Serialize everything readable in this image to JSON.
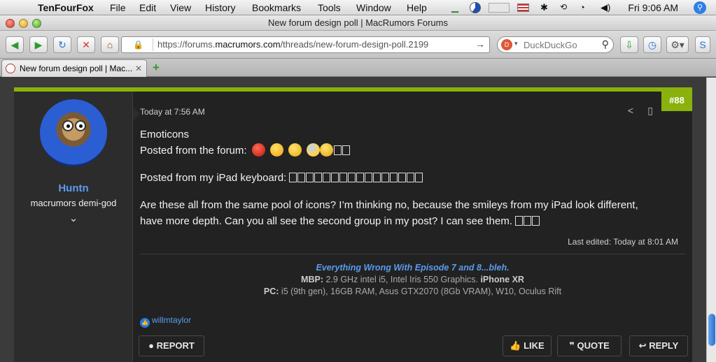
{
  "menubar": {
    "app": "TenFourFox",
    "items": [
      "File",
      "Edit",
      "View",
      "History",
      "Bookmarks",
      "Tools",
      "Window",
      "Help"
    ],
    "clock": "Fri 9:06 AM"
  },
  "window": {
    "title": "New forum design poll | MacRumors Forums"
  },
  "toolbar": {
    "url_prefix": "https://forums.",
    "url_domain": "macrumors.com",
    "url_path": "/threads/new-forum-design-poll.2199",
    "search_placeholder": "DuckDuckGo"
  },
  "tabs": [
    {
      "label": "New forum design poll | Mac..."
    }
  ],
  "post": {
    "user": {
      "name": "Huntn",
      "title": "macrumors demi-god"
    },
    "timestamp": "Today at 7:56 AM",
    "post_number": "#88",
    "body": {
      "line1": "Emoticons",
      "line2": "Posted from the forum:",
      "line3": "Posted from my iPad keyboard:",
      "line4": "Are these all from the same pool of icons? I’m thinking no, because the smileys from my iPad look different,",
      "line5": "have more depth. Can you all see the second group in my post? I can see them."
    },
    "edited": "Last edited: Today at 8:01 AM",
    "signature": {
      "line1a": "Everything Wrong With Episode 7",
      "line1b": "and",
      "line1c": "8...bleh.",
      "mbp_label": "MBP:",
      "mbp_value": "2.9 GHz intel i5, Intel Iris 550 Graphics.",
      "iphone": "iPhone XR",
      "pc_label": "PC:",
      "pc_value": "i5 (9th gen), 16GB RAM, Asus GTX2070 (8Gb VRAM), W10, Oculus Rift"
    },
    "liked_by": "willmtaylor",
    "buttons": {
      "report": "REPORT",
      "like": "LIKE",
      "quote": "QUOTE",
      "reply": "REPLY"
    }
  },
  "colors": {
    "accent": "#8ab10c",
    "link": "#5b9bef",
    "panel": "#2c2c2c",
    "post_bg": "#222222"
  }
}
